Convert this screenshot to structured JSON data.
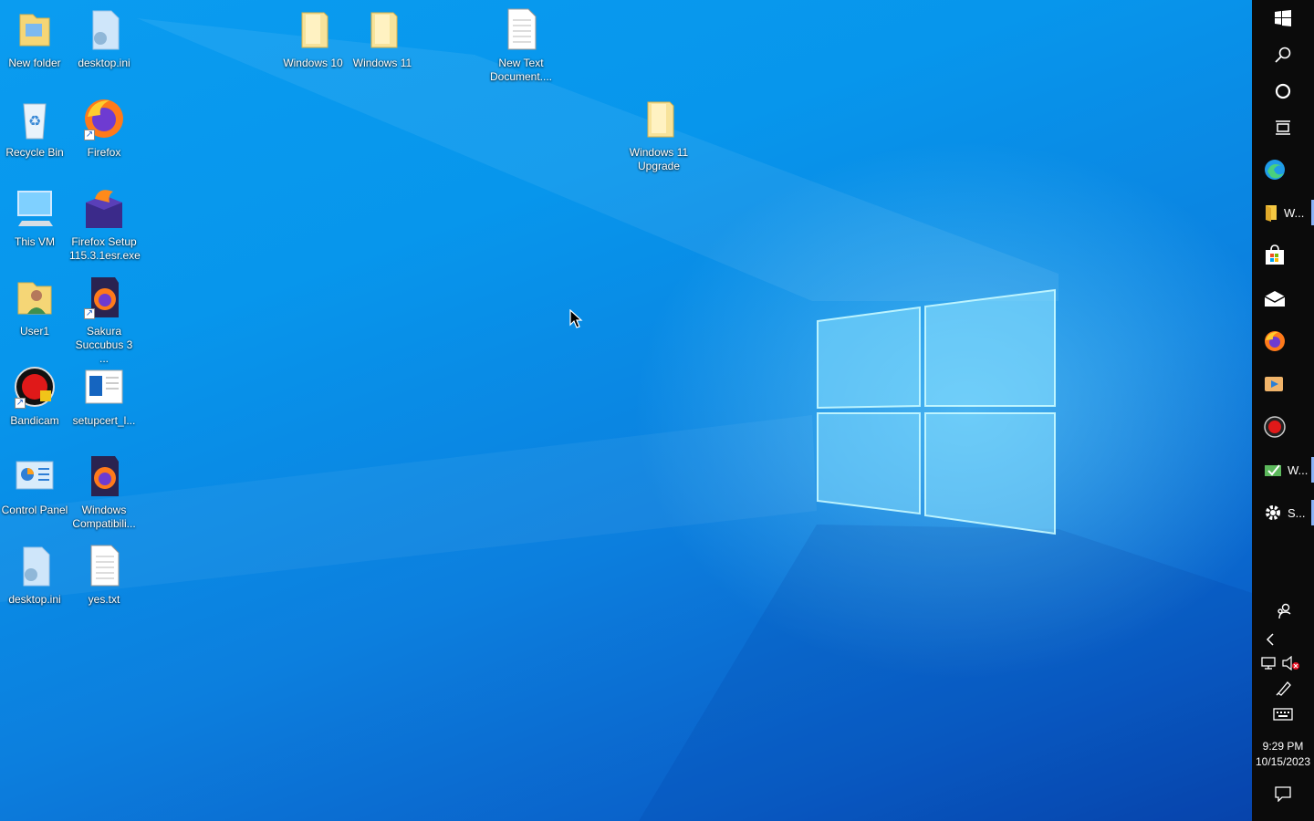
{
  "desktop": {
    "icons": [
      {
        "label": "New folder",
        "icon": "folder-icon"
      },
      {
        "label": "desktop.ini",
        "icon": "ini-file-icon"
      },
      {
        "label": "Windows 10",
        "icon": "folder-icon"
      },
      {
        "label": "Windows 11",
        "icon": "folder-icon"
      },
      {
        "label": "New Text Document....",
        "icon": "text-file-icon"
      },
      {
        "label": "Recycle Bin",
        "icon": "recycle-bin-icon"
      },
      {
        "label": "Firefox",
        "icon": "firefox-icon"
      },
      {
        "label": "Windows 11 Upgrade",
        "icon": "folder-icon"
      },
      {
        "label": "This VM",
        "icon": "computer-icon"
      },
      {
        "label": "Firefox Setup 115.3.1esr.exe",
        "icon": "firefox-setup-icon"
      },
      {
        "label": "User1",
        "icon": "user-folder-icon"
      },
      {
        "label": "Sakura Succubus 3 ...",
        "icon": "firefox-icon"
      },
      {
        "label": "Bandicam",
        "icon": "bandicam-icon"
      },
      {
        "label": "setupcert_l...",
        "icon": "document-icon"
      },
      {
        "label": "Control Panel",
        "icon": "control-panel-icon"
      },
      {
        "label": "Windows Compatibili...",
        "icon": "firefox-icon"
      },
      {
        "label": "desktop.ini",
        "icon": "ini-file-icon"
      },
      {
        "label": "yes.txt",
        "icon": "text-file-icon"
      }
    ]
  },
  "taskbar": {
    "buttons": [
      {
        "name": "start-button",
        "icon": "windows-logo-icon"
      },
      {
        "name": "search-button",
        "icon": "search-icon"
      },
      {
        "name": "cortana-button",
        "icon": "cortana-ring-icon"
      },
      {
        "name": "task-view-button",
        "icon": "task-view-icon"
      }
    ],
    "apps": [
      {
        "icon": "edge-icon",
        "label": ""
      },
      {
        "icon": "file-explorer-icon",
        "label": "W..."
      },
      {
        "icon": "microsoft-store-icon",
        "label": ""
      },
      {
        "icon": "mail-icon",
        "label": ""
      },
      {
        "icon": "firefox-icon",
        "label": ""
      },
      {
        "icon": "media-player-icon",
        "label": ""
      },
      {
        "icon": "bandicam-icon",
        "label": ""
      },
      {
        "icon": "windows-app-icon",
        "label": "W..."
      },
      {
        "icon": "settings-gear-icon",
        "label": "S..."
      }
    ],
    "tray": {
      "people_icon": "people-icon",
      "chevron_icon": "chevron-left-icon",
      "network_icon": "network-icon",
      "volume_icon": "volume-muted-icon",
      "pen_icon": "pen-icon",
      "keyboard_icon": "touch-keyboard-icon",
      "notification_icon": "action-center-icon"
    },
    "clock": {
      "time": "9:29 PM",
      "date": "10/15/2023"
    }
  },
  "colors": {
    "desktop_blue": "#0a9cf0",
    "taskbar_black": "#0b0b0b",
    "active_indicator": "#8ab4f8"
  }
}
